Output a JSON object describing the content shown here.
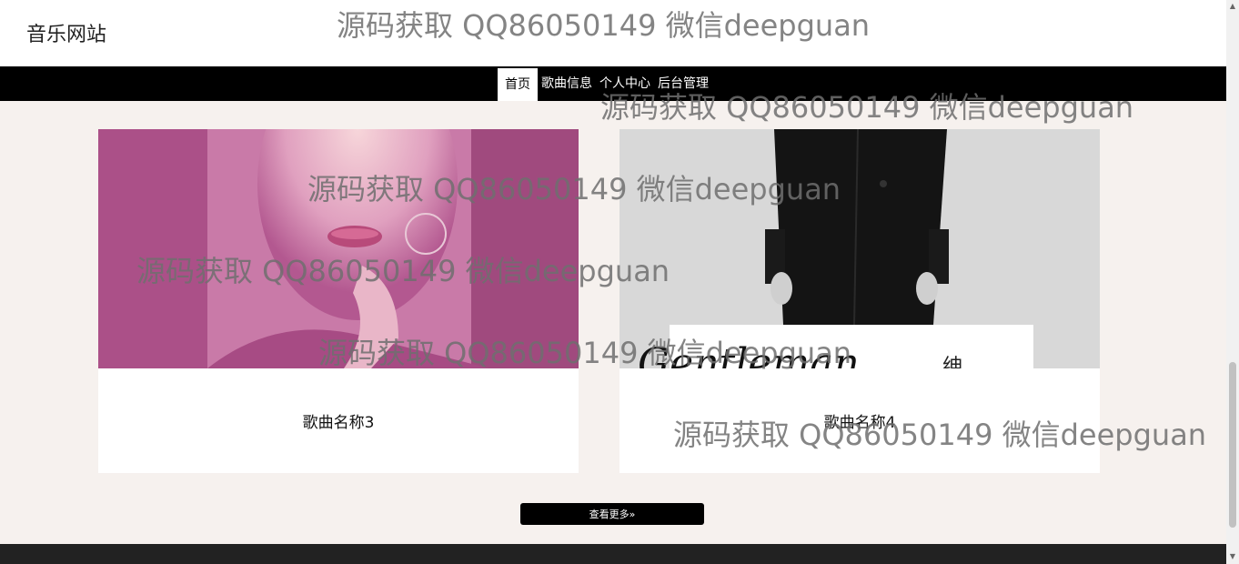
{
  "header": {
    "site_title": "音乐网站"
  },
  "nav": {
    "items": [
      {
        "label": "首页",
        "active": true
      },
      {
        "label": "歌曲信息"
      },
      {
        "label": "个人中心"
      },
      {
        "label": "后台管理"
      }
    ]
  },
  "songs": [
    {
      "name": "歌曲名称3"
    },
    {
      "name": "歌曲名称4",
      "image_text": [
        "Gentleman",
        "绅"
      ]
    }
  ],
  "more_button": {
    "label": "查看更多»"
  },
  "watermark": {
    "text": "源码获取 QQ86050149 微信deepguan"
  }
}
